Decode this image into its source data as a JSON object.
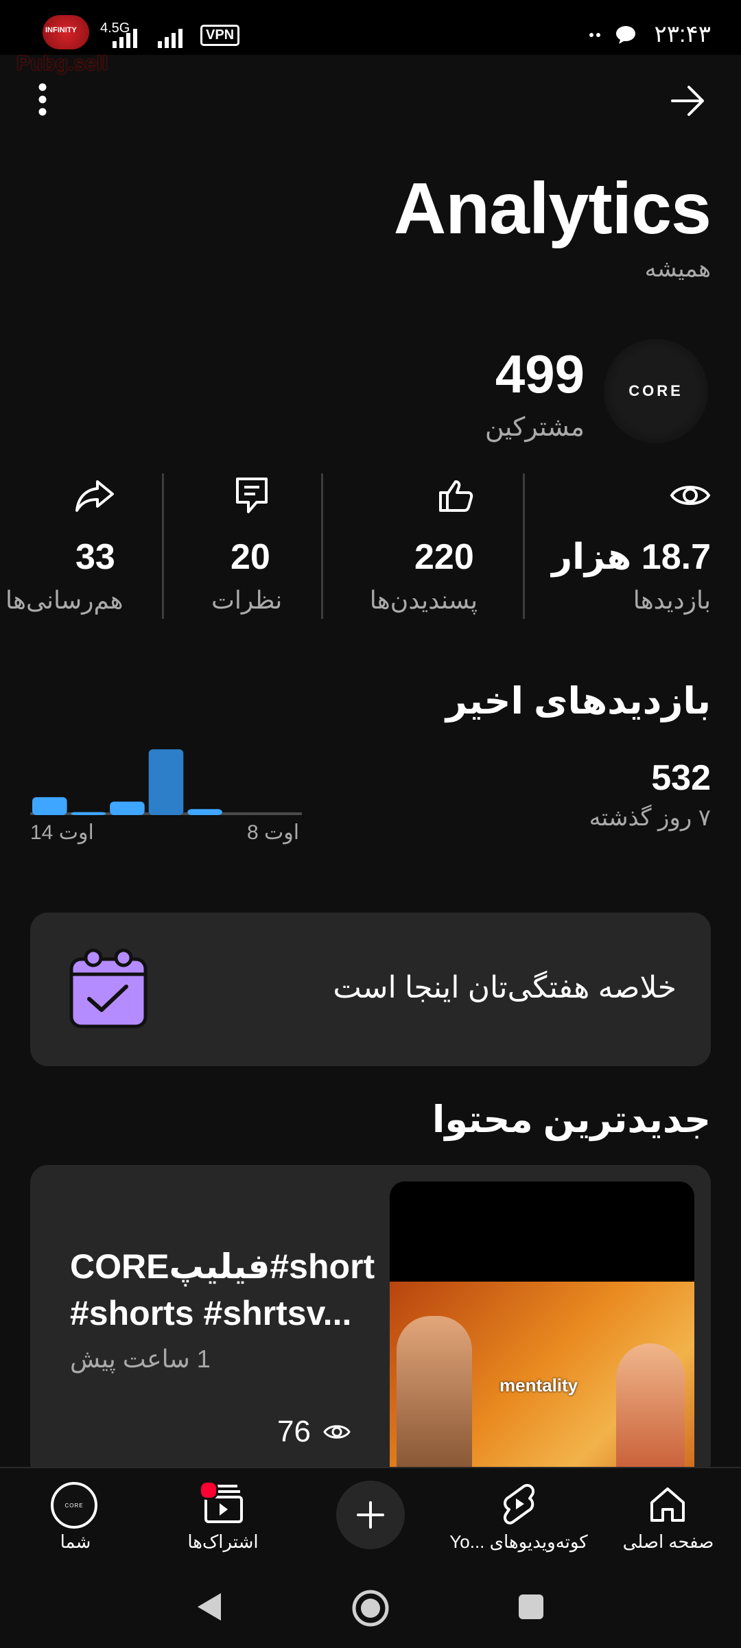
{
  "status_bar": {
    "time": "۲۳:۴۳",
    "network": "4.5G",
    "vpn": "VPN",
    "watermark_top": "INFINITY",
    "watermark_bottom": "Pubg.sell"
  },
  "header": {
    "title": "Analytics",
    "period": "همیشه"
  },
  "channel": {
    "subscribers_value": "499",
    "subscribers_label": "مشترکین",
    "avatar_text": "CORE"
  },
  "stats": [
    {
      "value": "18.7 هزار",
      "label": "بازدیدها",
      "icon": "eye-icon"
    },
    {
      "value": "220",
      "label": "پسندیدن‌ها",
      "icon": "thumbs-up-icon"
    },
    {
      "value": "20",
      "label": "نظرات",
      "icon": "comment-icon"
    },
    {
      "value": "33",
      "label": "هم‌رسانی‌ها",
      "icon": "share-icon"
    }
  ],
  "recent_views": {
    "title": "بازدیدهای اخیر",
    "value": "532",
    "period": "۷ روز گذشته",
    "x_start_label": "8 اوت",
    "x_end_label": "14 اوت"
  },
  "chart_data": {
    "type": "bar",
    "categories": [
      "8 اوت",
      "9 اوت",
      "10 اوت",
      "11 اوت",
      "12 اوت",
      "13 اوت",
      "14 اوت"
    ],
    "values": [
      0,
      0,
      8,
      88,
      18,
      4,
      24
    ],
    "xlabel": "",
    "ylabel": "",
    "ylim": [
      0,
      90
    ],
    "grid": false
  },
  "weekly_summary": {
    "text": "خلاصه هفتگی‌تان اینجا است",
    "icon": "calendar-check-icon"
  },
  "latest_content": {
    "title": "جدیدترین محتوا",
    "video_title": "CORE‌فیلیپ#short #shorts #shrtsv...",
    "time_ago": "1 ساعت پیش",
    "views": "76",
    "thumb_text": "mentality"
  },
  "bottom_nav": {
    "items": [
      {
        "label": "صفحه اصلی",
        "icon": "home-icon"
      },
      {
        "label": "کوته‌ویدیوهای ...Yo",
        "icon": "shorts-icon"
      },
      {
        "label": "",
        "icon": "create-plus-icon"
      },
      {
        "label": "اشتراک‌ها",
        "icon": "subscriptions-icon"
      },
      {
        "label": "شما",
        "icon": "profile-avatar-icon"
      }
    ]
  },
  "colors": {
    "background": "#0f0f0f",
    "card": "#272727",
    "accent_blue": "#3ea6ff",
    "notification_red": "#ff0033",
    "calendar_purple": "#b58cff"
  }
}
